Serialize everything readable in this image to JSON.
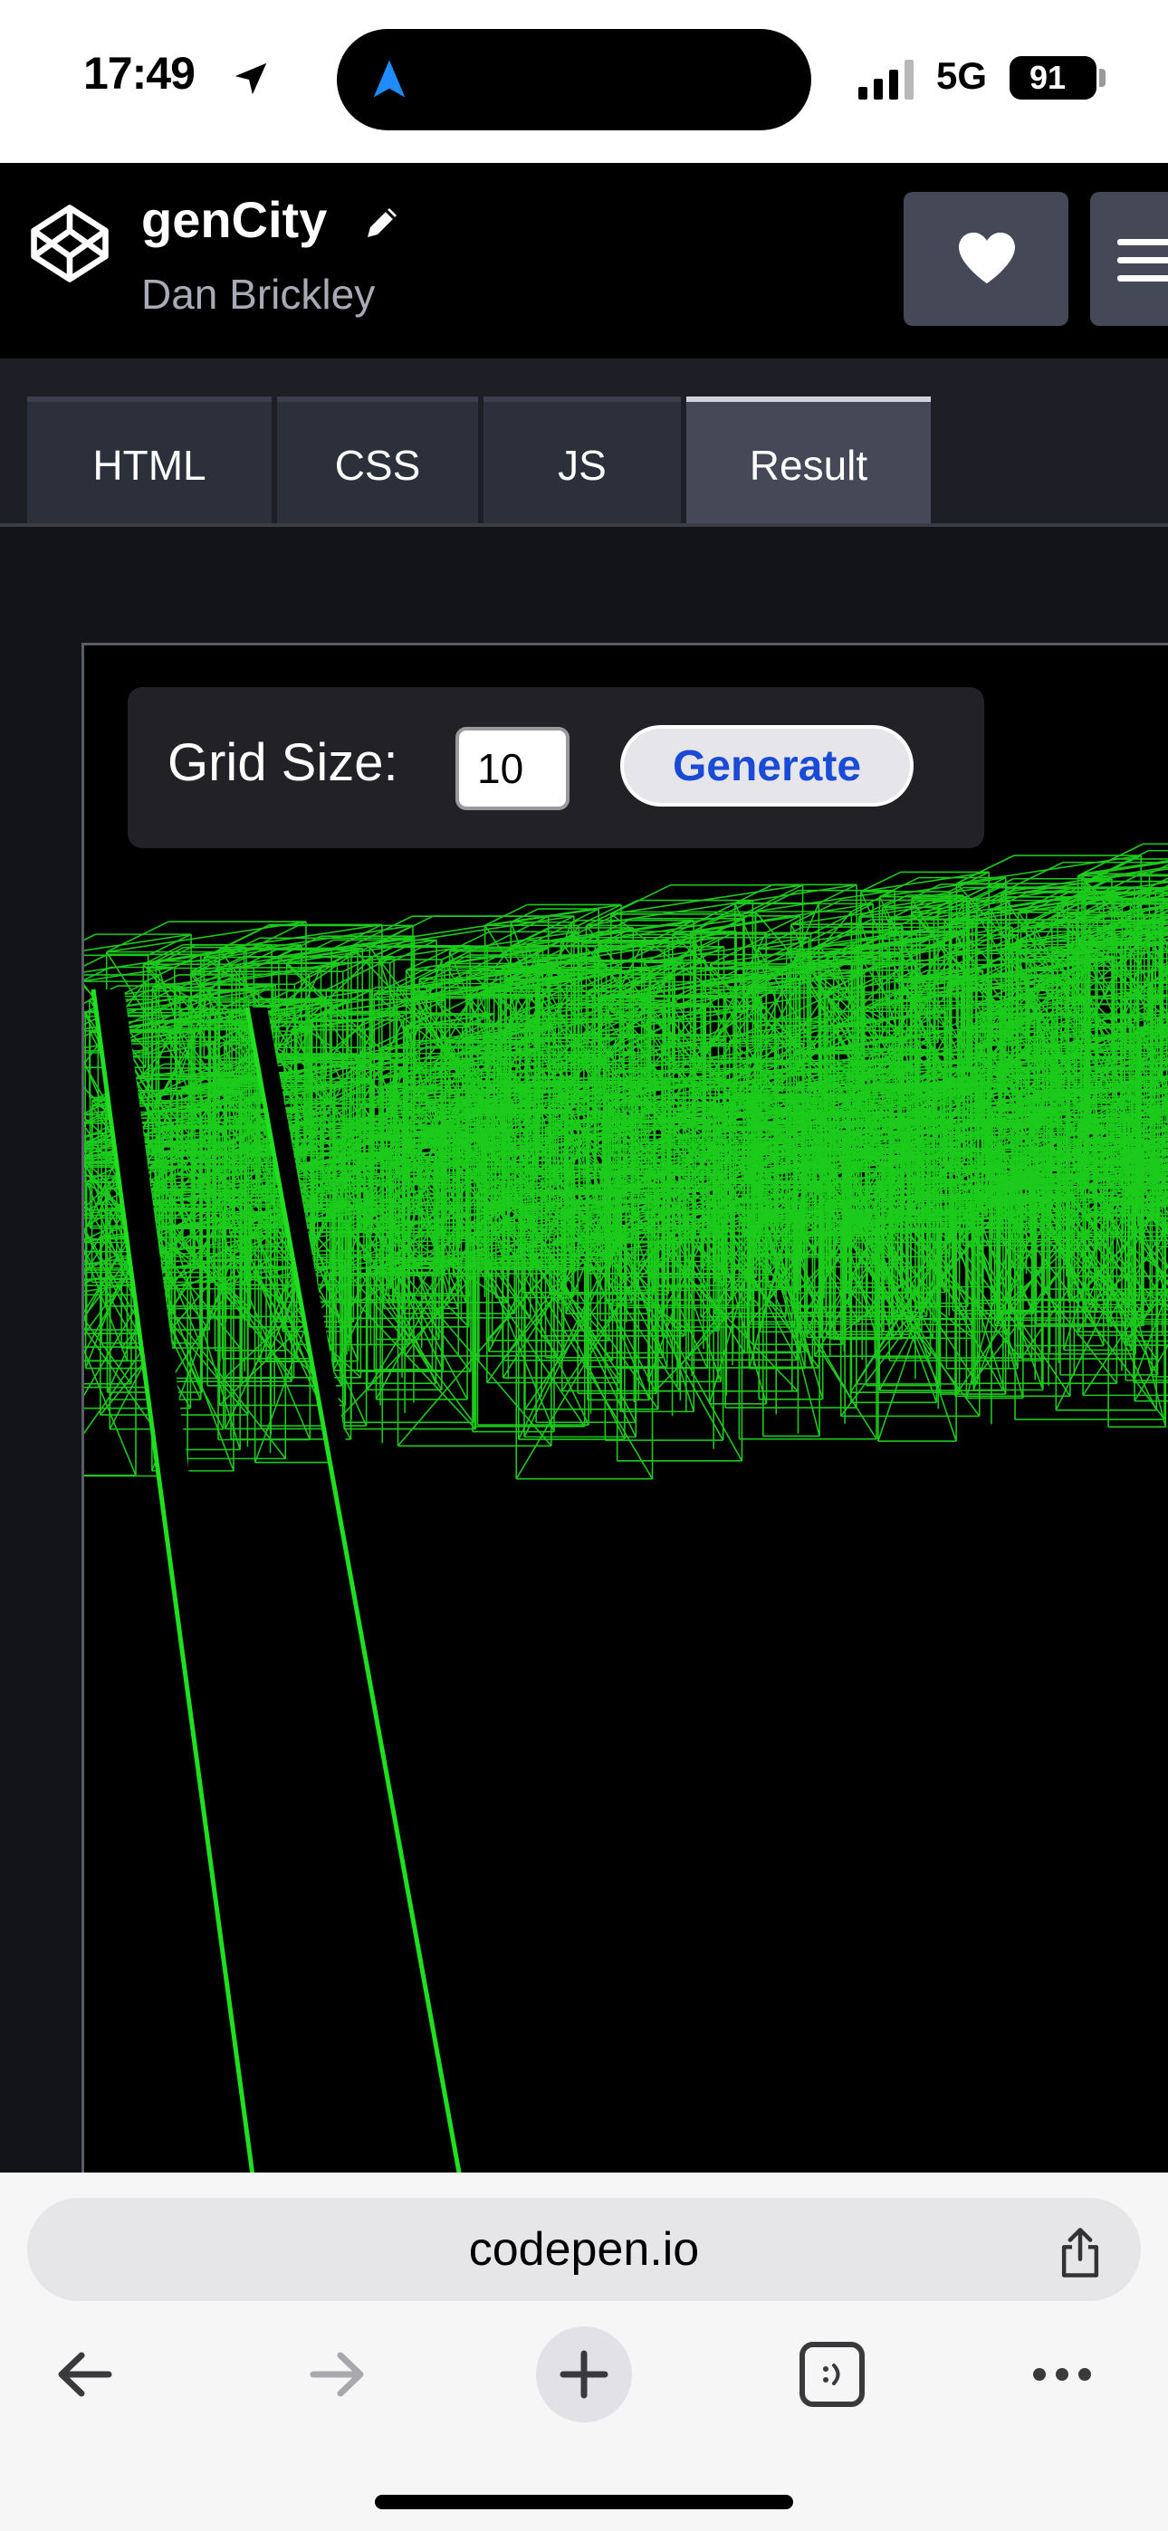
{
  "status_bar": {
    "time": "17:49",
    "carrier": "5G",
    "battery": "91"
  },
  "header": {
    "title": "genCity",
    "author": "Dan Brickley"
  },
  "tabs": [
    {
      "label": "HTML",
      "active": false
    },
    {
      "label": "CSS",
      "active": false
    },
    {
      "label": "JS",
      "active": false
    },
    {
      "label": "Result",
      "active": true
    }
  ],
  "result": {
    "grid_label": "Grid Size:",
    "grid_value": "10",
    "generate_label": "Generate",
    "wireframe_color": "#1fe01f"
  },
  "safari": {
    "url": "codepen.io"
  }
}
